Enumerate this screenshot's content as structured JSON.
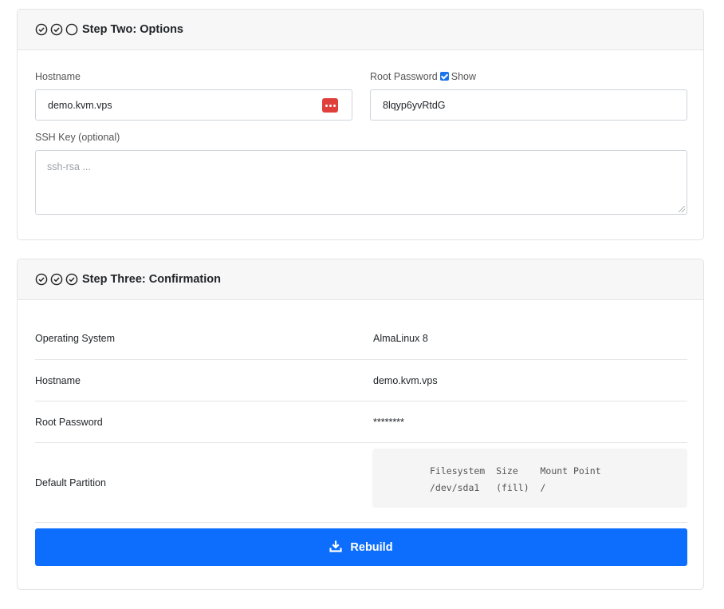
{
  "step_two": {
    "title": "Step Two: Options",
    "step_states": [
      "done",
      "done",
      "pending"
    ],
    "hostname_label": "Hostname",
    "hostname_value": "demo.kvm.vps",
    "root_password_label": "Root Password",
    "show_label": "Show",
    "show_checked": true,
    "root_password_value": "8lqyp6yvRtdG",
    "ssh_key_label": "SSH Key (optional)",
    "ssh_key_placeholder": "ssh-rsa ..."
  },
  "step_three": {
    "title": "Step Three: Confirmation",
    "step_states": [
      "done",
      "done",
      "done"
    ],
    "rows": [
      {
        "key": "Operating System",
        "value": "AlmaLinux 8"
      },
      {
        "key": "Hostname",
        "value": "demo.kvm.vps"
      },
      {
        "key": "Root Password",
        "value": "********"
      },
      {
        "key": "Default Partition",
        "value": ""
      }
    ],
    "partition_table": "Filesystem  Size    Mount Point\n/dev/sda1   (fill)  /",
    "rebuild_label": "Rebuild"
  },
  "colors": {
    "accent": "#0d6efd",
    "password_manager_badge": "#e0403c"
  },
  "icons": {
    "step_done": "check-circle-icon",
    "step_pending": "empty-circle-icon",
    "rebuild": "download-icon",
    "password_manager": "password-manager-icon"
  }
}
